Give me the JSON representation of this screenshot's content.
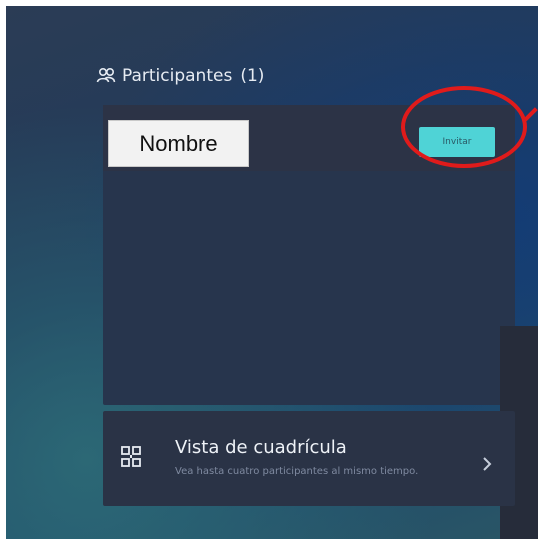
{
  "participants": {
    "title": "Participantes",
    "count": "(1)",
    "name_label": "Nombre",
    "invite_label": "Invitar"
  },
  "grid_view": {
    "title": "Vista de cuadrícula",
    "description": "Vea hasta cuatro participantes al mismo tiempo."
  },
  "icons": {
    "participants": "people-icon",
    "grid": "qr-grid-icon",
    "chevron": "chevron-right-icon"
  },
  "colors": {
    "accent": "#4fd3d6",
    "highlight": "#e01b1b",
    "panel": "#27354d"
  }
}
